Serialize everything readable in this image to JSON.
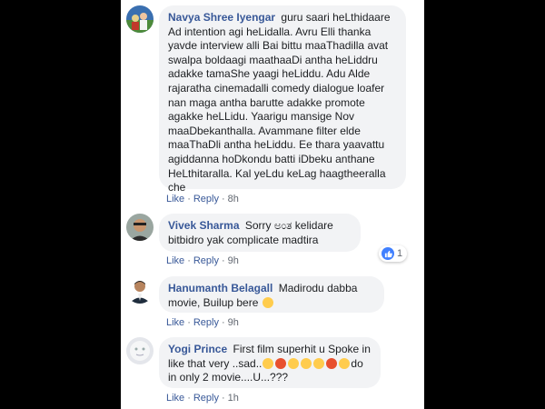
{
  "comments": [
    {
      "author": "Navya Shree Iyengar",
      "text": "guru saari heLthidaare Ad intention agi heLidalla. Avru Elli thanka yavde interview alli Bai bittu maaThadilla avat swalpa boldaagi maathaaDi antha heLiddru adakke tamaShe yaagi heLiddu. Adu Alde rajaratha cinemadalli comedy dialogue loafer nan maga antha barutte adakke promote agakke heLLidu. Yaarigu mansige Nov maaDbekanthalla. Avammane filter elde maaThaDli antha heLiddu. Ee thara yaavattu agiddanna hoDkondu batti iDbeku anthane HeLthitaralla. Kal yeLdu keLag haagtheeralla che",
      "like": "Like",
      "reply": "Reply",
      "time": "8h"
    },
    {
      "author": "Vivek Sharma",
      "text": "Sorry ಅಂತ kelidare bitbidro yak complicate madtira",
      "like": "Like",
      "reply": "Reply",
      "time": "9h",
      "reactions": "1"
    },
    {
      "author": "Hanumanth Belagall",
      "text": "Madirodu dabba movie, Builup bere",
      "like": "Like",
      "reply": "Reply",
      "time": "9h"
    },
    {
      "author": "Yogi Prince",
      "text_a": "First film superhit u Spoke in like that very ..sad..",
      "text_b": "do in only 2 movie....U...???",
      "like": "Like",
      "reply": "Reply",
      "time": "1h"
    }
  ],
  "colors": {
    "author_link": "#385898",
    "bubble_bg": "#f2f3f5",
    "meta_gray": "#616770",
    "like_blue": "#4080ff"
  }
}
